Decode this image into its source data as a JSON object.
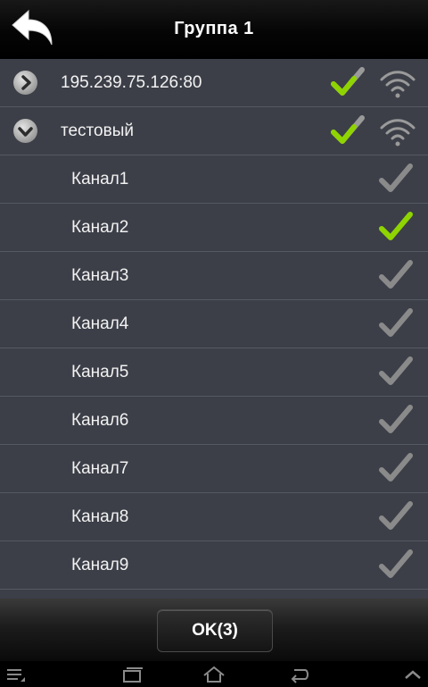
{
  "header": {
    "title": "Группа 1",
    "back_icon": "back-arrow-icon"
  },
  "groups": [
    {
      "label": "195.239.75.126:80",
      "expanded": false,
      "checked": true,
      "online": true
    },
    {
      "label": "тестовый",
      "expanded": true,
      "checked": true,
      "online": true
    }
  ],
  "channels": [
    {
      "label": "Канал1",
      "checked": false
    },
    {
      "label": "Канал2",
      "checked": true
    },
    {
      "label": "Канал3",
      "checked": false
    },
    {
      "label": "Канал4",
      "checked": false
    },
    {
      "label": "Канал5",
      "checked": false
    },
    {
      "label": "Канал6",
      "checked": false
    },
    {
      "label": "Канал7",
      "checked": false
    },
    {
      "label": "Канал8",
      "checked": false
    },
    {
      "label": "Канал9",
      "checked": false
    }
  ],
  "footer": {
    "ok_label": "OK(3)"
  },
  "system_nav": {
    "icons": [
      "menu-icon",
      "recent-apps-icon",
      "home-icon",
      "back-icon",
      "chevron-up-icon"
    ]
  },
  "colors": {
    "check_active": "#8fd400",
    "check_inactive": "#8a8a8a",
    "list_bg": "#3c3f48"
  }
}
